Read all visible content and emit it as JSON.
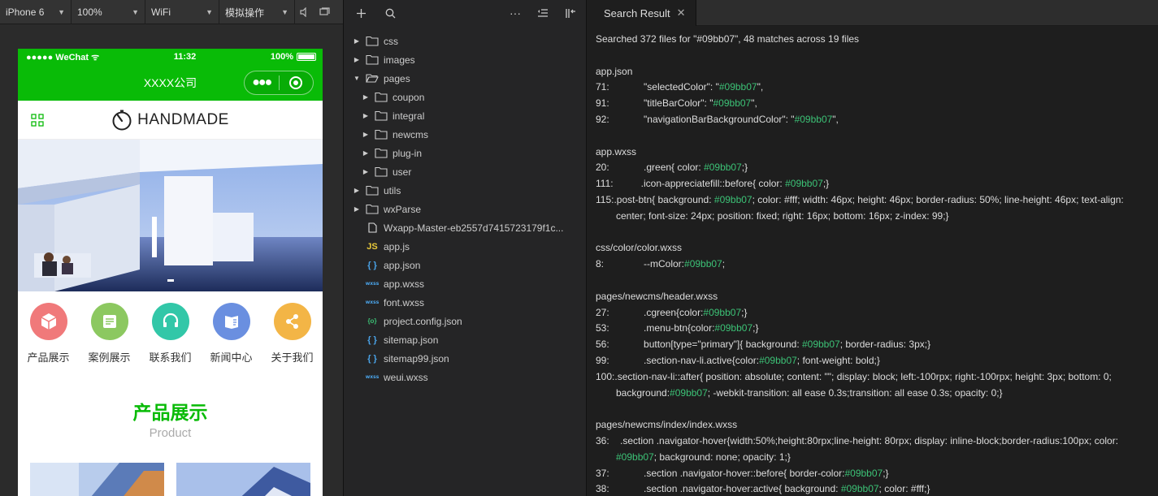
{
  "simulator": {
    "device": "iPhone 6",
    "zoom": "100%",
    "network": "WiFi",
    "mode": "模拟操作"
  },
  "phone": {
    "carrier": "●●●●● WeChat",
    "time": "11:32",
    "battery": "100%",
    "nav_title": "XXXX公司",
    "brand": "HANDMADE",
    "quicknav": [
      {
        "label": "产品展示",
        "color": "#f0797a",
        "icon": "box-icon"
      },
      {
        "label": "案例展示",
        "color": "#8cc860",
        "icon": "document-icon"
      },
      {
        "label": "联系我们",
        "color": "#32c7a8",
        "icon": "headset-icon"
      },
      {
        "label": "新闻中心",
        "color": "#6a8fe0",
        "icon": "news-icon"
      },
      {
        "label": "关于我们",
        "color": "#f3b546",
        "icon": "share-icon"
      }
    ],
    "section_title": "产品展示",
    "section_subtitle": "Product"
  },
  "accent_color": "#09bb07",
  "tree": [
    {
      "name": "css",
      "type": "folder",
      "depth": 0,
      "open": false
    },
    {
      "name": "images",
      "type": "folder",
      "depth": 0,
      "open": false
    },
    {
      "name": "pages",
      "type": "folder",
      "depth": 0,
      "open": true
    },
    {
      "name": "coupon",
      "type": "folder",
      "depth": 1,
      "open": false
    },
    {
      "name": "integral",
      "type": "folder",
      "depth": 1,
      "open": false
    },
    {
      "name": "newcms",
      "type": "folder",
      "depth": 1,
      "open": false
    },
    {
      "name": "plug-in",
      "type": "folder",
      "depth": 1,
      "open": false
    },
    {
      "name": "user",
      "type": "folder",
      "depth": 1,
      "open": false
    },
    {
      "name": "utils",
      "type": "folder",
      "depth": 0,
      "open": false
    },
    {
      "name": "wxParse",
      "type": "folder",
      "depth": 0,
      "open": false
    },
    {
      "name": "Wxapp-Master-eb2557d7415723179f1c...",
      "type": "file",
      "depth": 0
    },
    {
      "name": "app.js",
      "type": "js",
      "depth": 0
    },
    {
      "name": "app.json",
      "type": "json",
      "depth": 0
    },
    {
      "name": "app.wxss",
      "type": "wxss",
      "depth": 0
    },
    {
      "name": "font.wxss",
      "type": "wxss",
      "depth": 0
    },
    {
      "name": "project.config.json",
      "type": "cfg",
      "depth": 0
    },
    {
      "name": "sitemap.json",
      "type": "json",
      "depth": 0
    },
    {
      "name": "sitemap99.json",
      "type": "json",
      "depth": 0
    },
    {
      "name": "weui.wxss",
      "type": "wxss",
      "depth": 0
    }
  ],
  "icon_glyphs": {
    "js": "JS",
    "json": "{ }",
    "wxss": "wxss",
    "cfg": "{o}",
    "file": ""
  },
  "search": {
    "tab_label": "Search Result",
    "summary": "Searched 372 files for \"#09bb07\", 48 matches across 19 files",
    "groups": [
      {
        "file": "app.json",
        "matches": [
          {
            "line": "71:",
            "pre": "      \"selectedColor\": \"",
            "hl": "#09bb07",
            "post": "\","
          },
          {
            "line": "91:",
            "pre": "      \"titleBarColor\": \"",
            "hl": "#09bb07",
            "post": "\","
          },
          {
            "line": "92:",
            "pre": "      \"navigationBarBackgroundColor\": \"",
            "hl": "#09bb07",
            "post": "\","
          }
        ]
      },
      {
        "file": "app.wxss",
        "matches": [
          {
            "line": "20:",
            "pre": "      .green{ color: ",
            "hl": "#09bb07",
            "post": ";}"
          },
          {
            "line": "111:",
            "pre": "     .icon-appreciatefill::before{ color: ",
            "hl": "#09bb07",
            "post": ";}"
          },
          {
            "line": "115:",
            "pre": ".post-btn{ background: ",
            "hl": "#09bb07",
            "post": "; color: #fff; width: 46px; height: 46px; border-radius: 50%; line-height: 46px; text-align: center; font-size: 24px; position: fixed; right: 16px; bottom: 16px; z-index: 99;}",
            "wrap": true
          }
        ]
      },
      {
        "file": "css/color/color.wxss",
        "matches": [
          {
            "line": "8:",
            "pre": "      --mColor:",
            "hl": "#09bb07",
            "post": ";"
          }
        ]
      },
      {
        "file": "pages/newcms/header.wxss",
        "matches": [
          {
            "line": "27:",
            "pre": "      .cgreen{color:",
            "hl": "#09bb07",
            "post": ";}"
          },
          {
            "line": "53:",
            "pre": "      .menu-btn{color:",
            "hl": "#09bb07",
            "post": ";}"
          },
          {
            "line": "56:",
            "pre": "      button[type=\"primary\"]{ background: ",
            "hl": "#09bb07",
            "post": "; border-radius: 3px;}"
          },
          {
            "line": "99:",
            "pre": "      .section-nav-li.active{color:",
            "hl": "#09bb07",
            "post": "; font-weight: bold;}"
          },
          {
            "line": "100:",
            "pre": ".section-nav-li::after{ position: absolute; content: \"\"; display: block; left:-100rpx; right:-100rpx; height: 3px; bottom: 0; background:",
            "hl": "#09bb07",
            "post": "; -webkit-transition: all ease 0.3s;transition: all ease 0.3s; opacity: 0;}",
            "wrap": true
          }
        ]
      },
      {
        "file": "pages/newcms/index/index.wxss",
        "matches": [
          {
            "line": "36:",
            "pre": "    .section .navigator-hover{width:50%;height:80rpx;line-height: 80rpx; display: inline-block;border-radius:100px; color: ",
            "hl": "#09bb07",
            "post": "; background: none; opacity: 1;}",
            "wrap": true
          },
          {
            "line": "37:",
            "pre": "      .section .navigator-hover::before{ border-color:",
            "hl": "#09bb07",
            "post": ";}"
          },
          {
            "line": "38:",
            "pre": "      .section .navigator-hover:active{ background: ",
            "hl": "#09bb07",
            "post": "; color: #fff;}"
          }
        ]
      }
    ]
  }
}
